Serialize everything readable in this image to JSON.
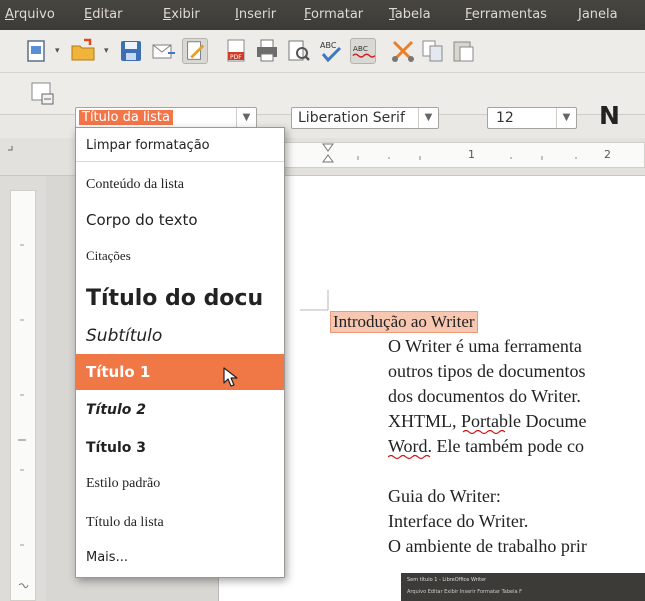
{
  "menubar": {
    "items": [
      "Arquivo",
      "Editar",
      "Exibir",
      "Inserir",
      "Formatar",
      "Tabela",
      "Ferramentas",
      "Janela"
    ]
  },
  "toolbar": {
    "icons": [
      "new-document",
      "open-folder",
      "save",
      "email",
      "edit-mode",
      "export-pdf",
      "print",
      "print-preview",
      "spellcheck",
      "autospellcheck",
      "cut",
      "copy",
      "paste"
    ]
  },
  "formatting": {
    "paragraph_style": "Título da lista",
    "font_name": "Liberation Serif",
    "font_size": "12",
    "bold_label": "N"
  },
  "ruler": {
    "labels": [
      "1",
      "2"
    ]
  },
  "style_menu": {
    "clear_formatting": "Limpar formatação",
    "items": [
      {
        "label": "Conteúdo da lista"
      },
      {
        "label": "Corpo do texto"
      },
      {
        "label": "Citações"
      },
      {
        "label": "Título do docu"
      },
      {
        "label": "Subtítulo"
      },
      {
        "label": "Título 1",
        "selected": true
      },
      {
        "label": "Título 2"
      },
      {
        "label": "Título 3"
      },
      {
        "label": "Estilo padrão"
      },
      {
        "label": "Título da lista"
      }
    ],
    "more": "Mais..."
  },
  "document": {
    "heading": "Introdução ao Writer",
    "lines": [
      "O Writer é uma ferramenta",
      "outros tipos de documentos",
      "dos documentos do Writer.",
      "XHTML, Portable Docume",
      "Word. Ele também pode co",
      "",
      "Guia do Writer:",
      "Interface do Writer.",
      "O ambiente de trabalho prir"
    ]
  },
  "thumbnail": {
    "title": "Sem título 1 - LibreOffice Writer",
    "menu": "Arquivo  Editar  Exibir  Inserir  Formatar  Tabela  F"
  },
  "colors": {
    "selection": "#f07746",
    "menubar_bg": "#3c3b37",
    "toolbar_bg": "#edece9"
  }
}
